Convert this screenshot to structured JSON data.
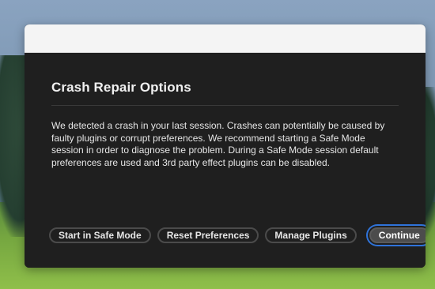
{
  "dialog": {
    "title": "Crash Repair Options",
    "message": "We detected a crash in your last session. Crashes can potentially be caused by faulty plugins or corrupt preferences. We recommend starting a Safe Mode session in order to diagnose the problem. During a Safe Mode session default preferences are used and 3rd party effect plugins can be disabled.",
    "buttons": {
      "safe_mode": "Start in Safe Mode",
      "reset_preferences": "Reset Preferences",
      "manage_plugins": "Manage Plugins",
      "continue": "Continue"
    }
  },
  "colors": {
    "dialog_background": "#1f1f1f",
    "titlebar_background": "#f4f4f4",
    "focus_ring": "#2f73d9",
    "primary_button": "#4c4c4c"
  }
}
